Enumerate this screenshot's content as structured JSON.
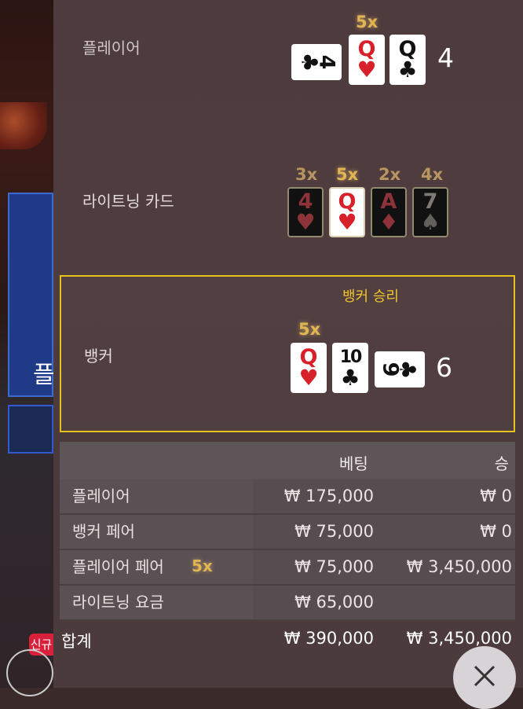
{
  "background": {
    "left_panel_text": "플",
    "new_badge": "신규"
  },
  "rows": {
    "player": {
      "label": "플레이어",
      "score": "4",
      "multiplier": "5x",
      "cards": [
        {
          "rank": "4",
          "suit": "♣",
          "color": "black",
          "rotated": true
        },
        {
          "rank": "Q",
          "suit": "♥",
          "color": "red",
          "rotated": false
        },
        {
          "rank": "Q",
          "suit": "♣",
          "color": "black",
          "rotated": false
        }
      ]
    },
    "lightning": {
      "label": "라이트닝 카드",
      "cards": [
        {
          "rank": "4",
          "suit": "♥",
          "multiplier": "3x",
          "style": "dark-red"
        },
        {
          "rank": "Q",
          "suit": "♥",
          "multiplier": "5x",
          "style": "white-red"
        },
        {
          "rank": "A",
          "suit": "♦",
          "multiplier": "2x",
          "style": "dark-red"
        },
        {
          "rank": "7",
          "suit": "♠",
          "multiplier": "4x",
          "style": "dark-black"
        }
      ]
    },
    "banker": {
      "label": "뱅커",
      "win_text": "뱅커 승리",
      "score": "6",
      "multiplier": "5x",
      "cards": [
        {
          "rank": "Q",
          "suit": "♥",
          "color": "red",
          "rotated": false
        },
        {
          "rank": "10",
          "suit": "♣",
          "color": "black",
          "rotated": false
        },
        {
          "rank": "9",
          "suit": "♣",
          "color": "black",
          "rotated": true
        }
      ]
    }
  },
  "bet_table": {
    "headers": {
      "bet": "베팅",
      "win": "승"
    },
    "rows": [
      {
        "name": "플레이어",
        "multiplier": "",
        "bet": "₩ 175,000",
        "win": "₩ 0"
      },
      {
        "name": "뱅커 페어",
        "multiplier": "",
        "bet": "₩ 75,000",
        "win": "₩ 0"
      },
      {
        "name": "플레이어 페어",
        "multiplier": "5x",
        "bet": "₩ 75,000",
        "win": "₩ 3,450,000"
      },
      {
        "name": "라이트닝 요금",
        "multiplier": "",
        "bet": "₩ 65,000",
        "win": ""
      }
    ],
    "total": {
      "name": "합계",
      "bet": "₩ 390,000",
      "win": "₩ 3,450,000"
    }
  },
  "close_icon": "close-icon"
}
